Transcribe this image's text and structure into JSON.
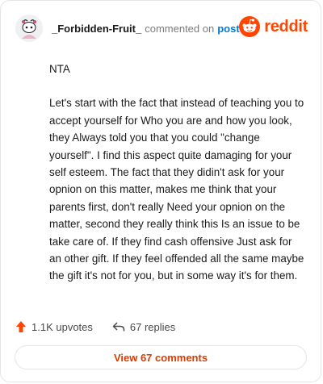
{
  "header": {
    "username": "_Forbidden-Fruit_",
    "action_text": "commented on",
    "post_link": "post",
    "brand": "reddit"
  },
  "comment": {
    "paragraphs": [
      "NTA",
      "Let's start with the fact that instead of teaching you to accept yourself for Who you are and how you look, they Always told you that you could \"change yourself\". I find this aspect quite damaging for your self esteem. The fact that they didin't ask for your opnion on this matter, makes me think that your parents first, don't really Need your opnion on the matter, second they really think this Is an issue to be take care of. If they find cash offensive Just ask for an other gift. If they feel offended all the same maybe the gift it's not for you, but in some way it's for them."
    ]
  },
  "footer": {
    "upvotes": "1.1K upvotes",
    "replies": "67 replies",
    "view_comments": "View 67 comments"
  },
  "icons": {
    "avatar": "snoo-avatar-icon",
    "brand": "reddit-logo-icon",
    "upvote": "upvote-arrow-icon",
    "reply": "reply-arrow-icon"
  },
  "colors": {
    "brand": "#ff4500",
    "link": "#0079d3",
    "upvote": "#ff4500",
    "view_button_text": "#d93a00"
  }
}
